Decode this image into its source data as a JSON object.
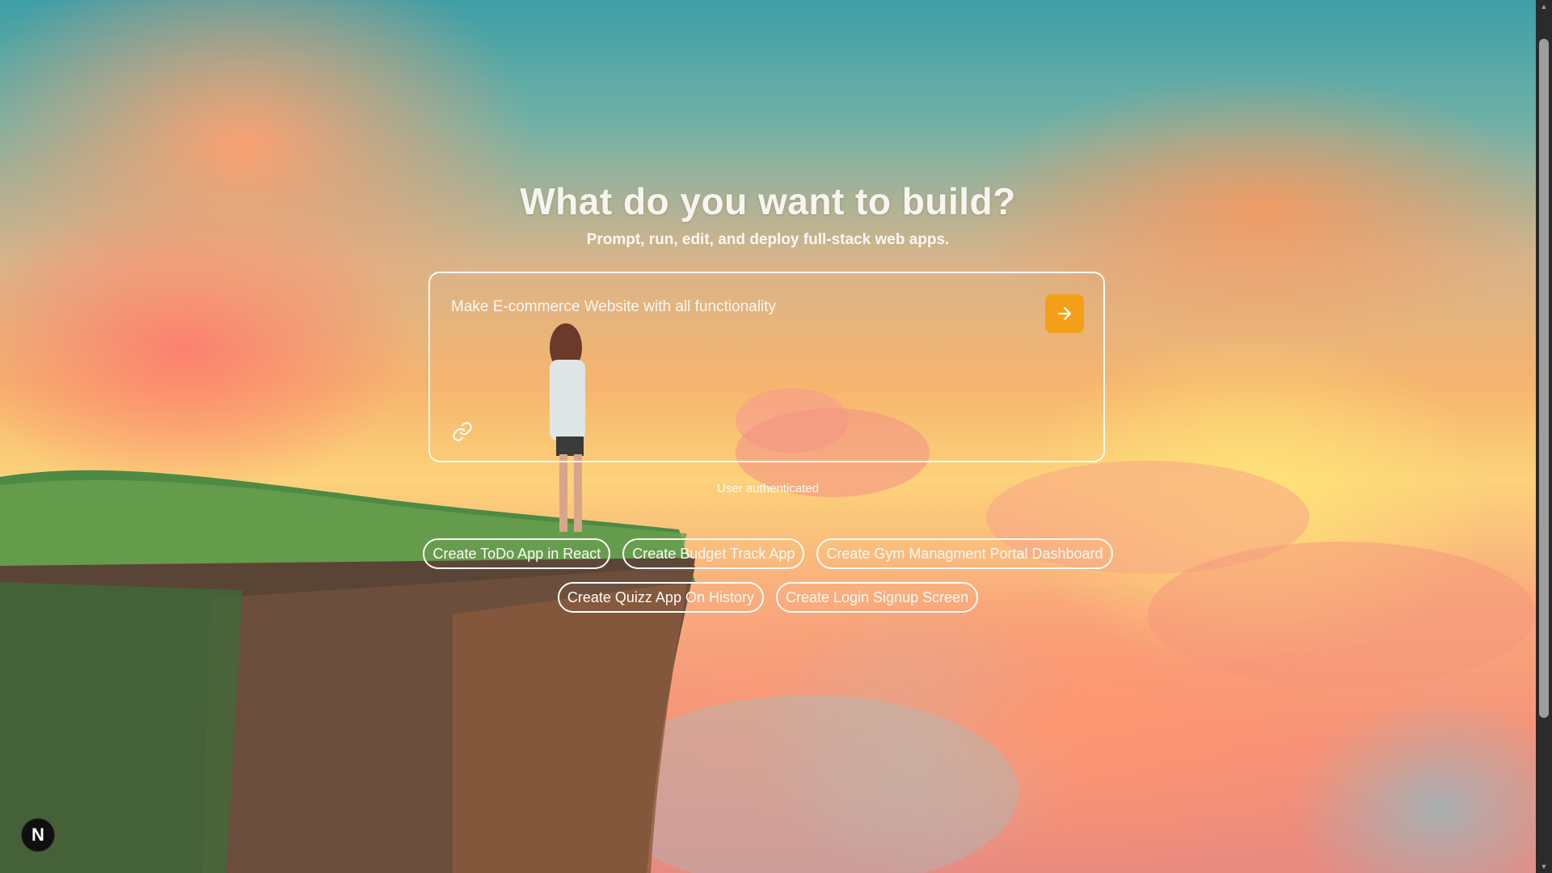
{
  "hero": {
    "title": "What do you want to build?",
    "subtitle": "Prompt, run, edit, and deploy full-stack web apps."
  },
  "prompt": {
    "value": "Make E-commerce Website with all functionality",
    "send_icon": "arrow-right-icon",
    "attach_icon": "link-icon"
  },
  "status": {
    "auth": "User authenticated"
  },
  "suggestions": {
    "row1": [
      "Create ToDo App in React",
      "Create Budget Track App",
      "Create Gym Managment Portal Dashboard"
    ],
    "row2": [
      "Create Quizz App On History",
      "Create Login Signup Screen"
    ]
  },
  "badge": {
    "letter": "N"
  },
  "colors": {
    "accent": "#f3a018",
    "text": "#fdfaf6"
  }
}
